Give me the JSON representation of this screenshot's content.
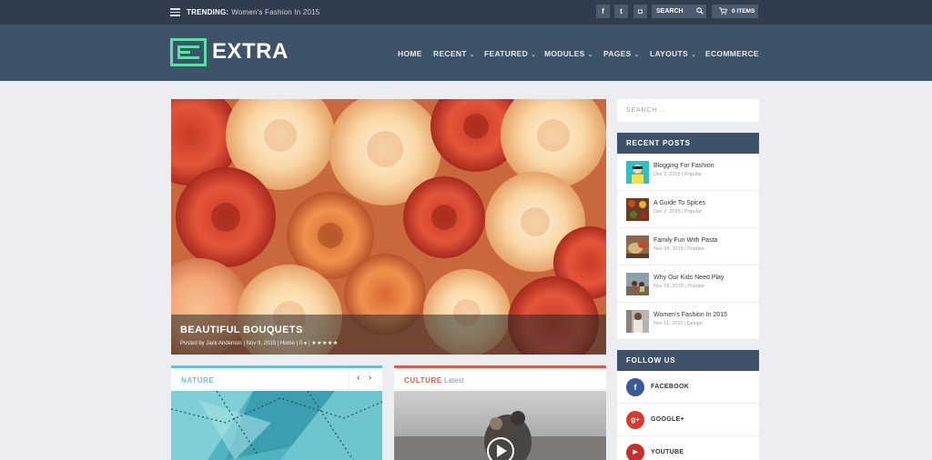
{
  "topbar": {
    "trending_label": "TRENDING:",
    "trending_text": "Women's Fashion In 2015",
    "social": [
      {
        "name": "facebook-icon",
        "glyph": "f"
      },
      {
        "name": "twitter-icon",
        "glyph": "t"
      },
      {
        "name": "instagram-icon",
        "glyph": "◘"
      }
    ],
    "search_placeholder": "SEARCH",
    "cart_label": "0 ITEMS"
  },
  "header": {
    "logo_text": "EXTRA",
    "nav": [
      {
        "label": "HOME",
        "has_dropdown": false
      },
      {
        "label": "RECENT",
        "has_dropdown": true
      },
      {
        "label": "FEATURED",
        "has_dropdown": true
      },
      {
        "label": "MODULES",
        "has_dropdown": true
      },
      {
        "label": "PAGES",
        "has_dropdown": true
      },
      {
        "label": "LAYOUTS",
        "has_dropdown": true
      },
      {
        "label": "ECOMMERCE",
        "has_dropdown": false
      }
    ]
  },
  "hero": {
    "title": "BEAUTIFUL BOUQUETS",
    "meta": "Posted by Jack Anderson | Nov 9, 2015 | Home | 0",
    "rating": "★★★★★"
  },
  "cards": [
    {
      "label": "NATURE",
      "sub": "",
      "accent": "#6cc1cf"
    },
    {
      "label": "CULTURE",
      "sub": "Latest",
      "accent": "#e45a47"
    }
  ],
  "sidebar": {
    "search_placeholder": "SEARCH ...",
    "recent_title": "RECENT POSTS",
    "posts": [
      {
        "title": "Blogging For Fashion",
        "meta": "Dec 2, 2015 | Popular"
      },
      {
        "title": "A Guide To Spices",
        "meta": "Dec 2, 2015 | Popular"
      },
      {
        "title": "Family Fun With Pasta",
        "meta": "Nov 24, 2015 | Popular"
      },
      {
        "title": "Why Our Kids Need Play",
        "meta": "Nov 18, 2015 | Popular"
      },
      {
        "title": "Women's Fashion In 2015",
        "meta": "Nov 11, 2015 | Design"
      }
    ],
    "follow_title": "FOLLOW US",
    "follow": [
      {
        "label": "FACEBOOK",
        "glyph": "f",
        "color": "#3b5998"
      },
      {
        "label": "GOOGLE+",
        "glyph": "g+",
        "color": "#d63a2f"
      },
      {
        "label": "YOUTUBE",
        "glyph": "▶",
        "color": "#c4302b"
      }
    ]
  },
  "colors": {
    "topbar": "#2f3d4d",
    "header": "#3e5269",
    "logo_accent": "#5ae1a6",
    "page_bg": "#ecedf1"
  }
}
